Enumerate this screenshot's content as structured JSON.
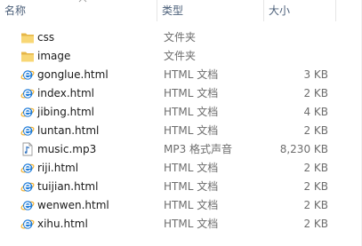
{
  "columns": {
    "name": "名称",
    "type": "类型",
    "size": "大小"
  },
  "files": [
    {
      "name": "css",
      "type": "文件夹",
      "size": "",
      "icon": "folder-icon"
    },
    {
      "name": "image",
      "type": "文件夹",
      "size": "",
      "icon": "folder-icon"
    },
    {
      "name": "gonglue.html",
      "type": "HTML 文档",
      "size": "3 KB",
      "icon": "ie-html-icon"
    },
    {
      "name": "index.html",
      "type": "HTML 文档",
      "size": "2 KB",
      "icon": "ie-html-icon"
    },
    {
      "name": "jibing.html",
      "type": "HTML 文档",
      "size": "4 KB",
      "icon": "ie-html-icon"
    },
    {
      "name": "luntan.html",
      "type": "HTML 文档",
      "size": "2 KB",
      "icon": "ie-html-icon"
    },
    {
      "name": "music.mp3",
      "type": "MP3 格式声音",
      "size": "8,230 KB",
      "icon": "audio-file-icon"
    },
    {
      "name": "riji.html",
      "type": "HTML 文档",
      "size": "2 KB",
      "icon": "ie-html-icon"
    },
    {
      "name": "tuijian.html",
      "type": "HTML 文档",
      "size": "2 KB",
      "icon": "ie-html-icon"
    },
    {
      "name": "wenwen.html",
      "type": "HTML 文档",
      "size": "2 KB",
      "icon": "ie-html-icon"
    },
    {
      "name": "xihu.html",
      "type": "HTML 文档",
      "size": "2 KB",
      "icon": "ie-html-icon"
    }
  ],
  "colors": {
    "header_text": "#4c607a",
    "folder_yellow": "#f6d36b",
    "ie_blue": "#1b7ad9",
    "ie_ring": "#f2b233"
  }
}
